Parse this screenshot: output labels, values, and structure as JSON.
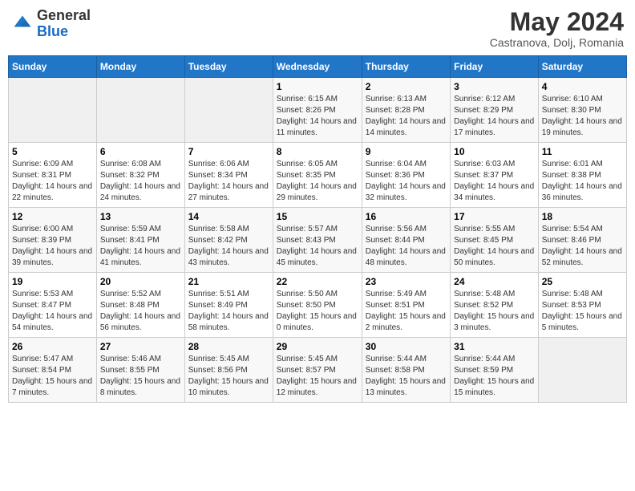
{
  "logo": {
    "general": "General",
    "blue": "Blue"
  },
  "header": {
    "month": "May 2024",
    "location": "Castranova, Dolj, Romania"
  },
  "weekdays": [
    "Sunday",
    "Monday",
    "Tuesday",
    "Wednesday",
    "Thursday",
    "Friday",
    "Saturday"
  ],
  "weeks": [
    [
      {
        "day": "",
        "sunrise": "",
        "sunset": "",
        "daylight": ""
      },
      {
        "day": "",
        "sunrise": "",
        "sunset": "",
        "daylight": ""
      },
      {
        "day": "",
        "sunrise": "",
        "sunset": "",
        "daylight": ""
      },
      {
        "day": "1",
        "sunrise": "Sunrise: 6:15 AM",
        "sunset": "Sunset: 8:26 PM",
        "daylight": "Daylight: 14 hours and 11 minutes."
      },
      {
        "day": "2",
        "sunrise": "Sunrise: 6:13 AM",
        "sunset": "Sunset: 8:28 PM",
        "daylight": "Daylight: 14 hours and 14 minutes."
      },
      {
        "day": "3",
        "sunrise": "Sunrise: 6:12 AM",
        "sunset": "Sunset: 8:29 PM",
        "daylight": "Daylight: 14 hours and 17 minutes."
      },
      {
        "day": "4",
        "sunrise": "Sunrise: 6:10 AM",
        "sunset": "Sunset: 8:30 PM",
        "daylight": "Daylight: 14 hours and 19 minutes."
      }
    ],
    [
      {
        "day": "5",
        "sunrise": "Sunrise: 6:09 AM",
        "sunset": "Sunset: 8:31 PM",
        "daylight": "Daylight: 14 hours and 22 minutes."
      },
      {
        "day": "6",
        "sunrise": "Sunrise: 6:08 AM",
        "sunset": "Sunset: 8:32 PM",
        "daylight": "Daylight: 14 hours and 24 minutes."
      },
      {
        "day": "7",
        "sunrise": "Sunrise: 6:06 AM",
        "sunset": "Sunset: 8:34 PM",
        "daylight": "Daylight: 14 hours and 27 minutes."
      },
      {
        "day": "8",
        "sunrise": "Sunrise: 6:05 AM",
        "sunset": "Sunset: 8:35 PM",
        "daylight": "Daylight: 14 hours and 29 minutes."
      },
      {
        "day": "9",
        "sunrise": "Sunrise: 6:04 AM",
        "sunset": "Sunset: 8:36 PM",
        "daylight": "Daylight: 14 hours and 32 minutes."
      },
      {
        "day": "10",
        "sunrise": "Sunrise: 6:03 AM",
        "sunset": "Sunset: 8:37 PM",
        "daylight": "Daylight: 14 hours and 34 minutes."
      },
      {
        "day": "11",
        "sunrise": "Sunrise: 6:01 AM",
        "sunset": "Sunset: 8:38 PM",
        "daylight": "Daylight: 14 hours and 36 minutes."
      }
    ],
    [
      {
        "day": "12",
        "sunrise": "Sunrise: 6:00 AM",
        "sunset": "Sunset: 8:39 PM",
        "daylight": "Daylight: 14 hours and 39 minutes."
      },
      {
        "day": "13",
        "sunrise": "Sunrise: 5:59 AM",
        "sunset": "Sunset: 8:41 PM",
        "daylight": "Daylight: 14 hours and 41 minutes."
      },
      {
        "day": "14",
        "sunrise": "Sunrise: 5:58 AM",
        "sunset": "Sunset: 8:42 PM",
        "daylight": "Daylight: 14 hours and 43 minutes."
      },
      {
        "day": "15",
        "sunrise": "Sunrise: 5:57 AM",
        "sunset": "Sunset: 8:43 PM",
        "daylight": "Daylight: 14 hours and 45 minutes."
      },
      {
        "day": "16",
        "sunrise": "Sunrise: 5:56 AM",
        "sunset": "Sunset: 8:44 PM",
        "daylight": "Daylight: 14 hours and 48 minutes."
      },
      {
        "day": "17",
        "sunrise": "Sunrise: 5:55 AM",
        "sunset": "Sunset: 8:45 PM",
        "daylight": "Daylight: 14 hours and 50 minutes."
      },
      {
        "day": "18",
        "sunrise": "Sunrise: 5:54 AM",
        "sunset": "Sunset: 8:46 PM",
        "daylight": "Daylight: 14 hours and 52 minutes."
      }
    ],
    [
      {
        "day": "19",
        "sunrise": "Sunrise: 5:53 AM",
        "sunset": "Sunset: 8:47 PM",
        "daylight": "Daylight: 14 hours and 54 minutes."
      },
      {
        "day": "20",
        "sunrise": "Sunrise: 5:52 AM",
        "sunset": "Sunset: 8:48 PM",
        "daylight": "Daylight: 14 hours and 56 minutes."
      },
      {
        "day": "21",
        "sunrise": "Sunrise: 5:51 AM",
        "sunset": "Sunset: 8:49 PM",
        "daylight": "Daylight: 14 hours and 58 minutes."
      },
      {
        "day": "22",
        "sunrise": "Sunrise: 5:50 AM",
        "sunset": "Sunset: 8:50 PM",
        "daylight": "Daylight: 15 hours and 0 minutes."
      },
      {
        "day": "23",
        "sunrise": "Sunrise: 5:49 AM",
        "sunset": "Sunset: 8:51 PM",
        "daylight": "Daylight: 15 hours and 2 minutes."
      },
      {
        "day": "24",
        "sunrise": "Sunrise: 5:48 AM",
        "sunset": "Sunset: 8:52 PM",
        "daylight": "Daylight: 15 hours and 3 minutes."
      },
      {
        "day": "25",
        "sunrise": "Sunrise: 5:48 AM",
        "sunset": "Sunset: 8:53 PM",
        "daylight": "Daylight: 15 hours and 5 minutes."
      }
    ],
    [
      {
        "day": "26",
        "sunrise": "Sunrise: 5:47 AM",
        "sunset": "Sunset: 8:54 PM",
        "daylight": "Daylight: 15 hours and 7 minutes."
      },
      {
        "day": "27",
        "sunrise": "Sunrise: 5:46 AM",
        "sunset": "Sunset: 8:55 PM",
        "daylight": "Daylight: 15 hours and 8 minutes."
      },
      {
        "day": "28",
        "sunrise": "Sunrise: 5:45 AM",
        "sunset": "Sunset: 8:56 PM",
        "daylight": "Daylight: 15 hours and 10 minutes."
      },
      {
        "day": "29",
        "sunrise": "Sunrise: 5:45 AM",
        "sunset": "Sunset: 8:57 PM",
        "daylight": "Daylight: 15 hours and 12 minutes."
      },
      {
        "day": "30",
        "sunrise": "Sunrise: 5:44 AM",
        "sunset": "Sunset: 8:58 PM",
        "daylight": "Daylight: 15 hours and 13 minutes."
      },
      {
        "day": "31",
        "sunrise": "Sunrise: 5:44 AM",
        "sunset": "Sunset: 8:59 PM",
        "daylight": "Daylight: 15 hours and 15 minutes."
      },
      {
        "day": "",
        "sunrise": "",
        "sunset": "",
        "daylight": ""
      }
    ]
  ]
}
